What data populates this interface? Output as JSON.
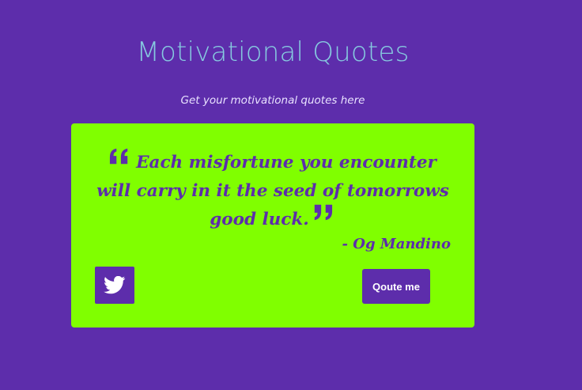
{
  "header": {
    "title": "Motivational Quotes",
    "subtitle": "Get your motivational quotes here"
  },
  "quote": {
    "text": "Each misfortune you encounter will carry in it the seed of tomorrows good luck.",
    "author": "- Og Mandino"
  },
  "actions": {
    "tweet_icon": "twitter-icon",
    "new_quote_label": "Qoute me"
  },
  "colors": {
    "background": "#5d2dab",
    "card": "#80ff00",
    "title": "#86c9df",
    "accent": "#5d2dab",
    "button_text": "#ffffff"
  }
}
